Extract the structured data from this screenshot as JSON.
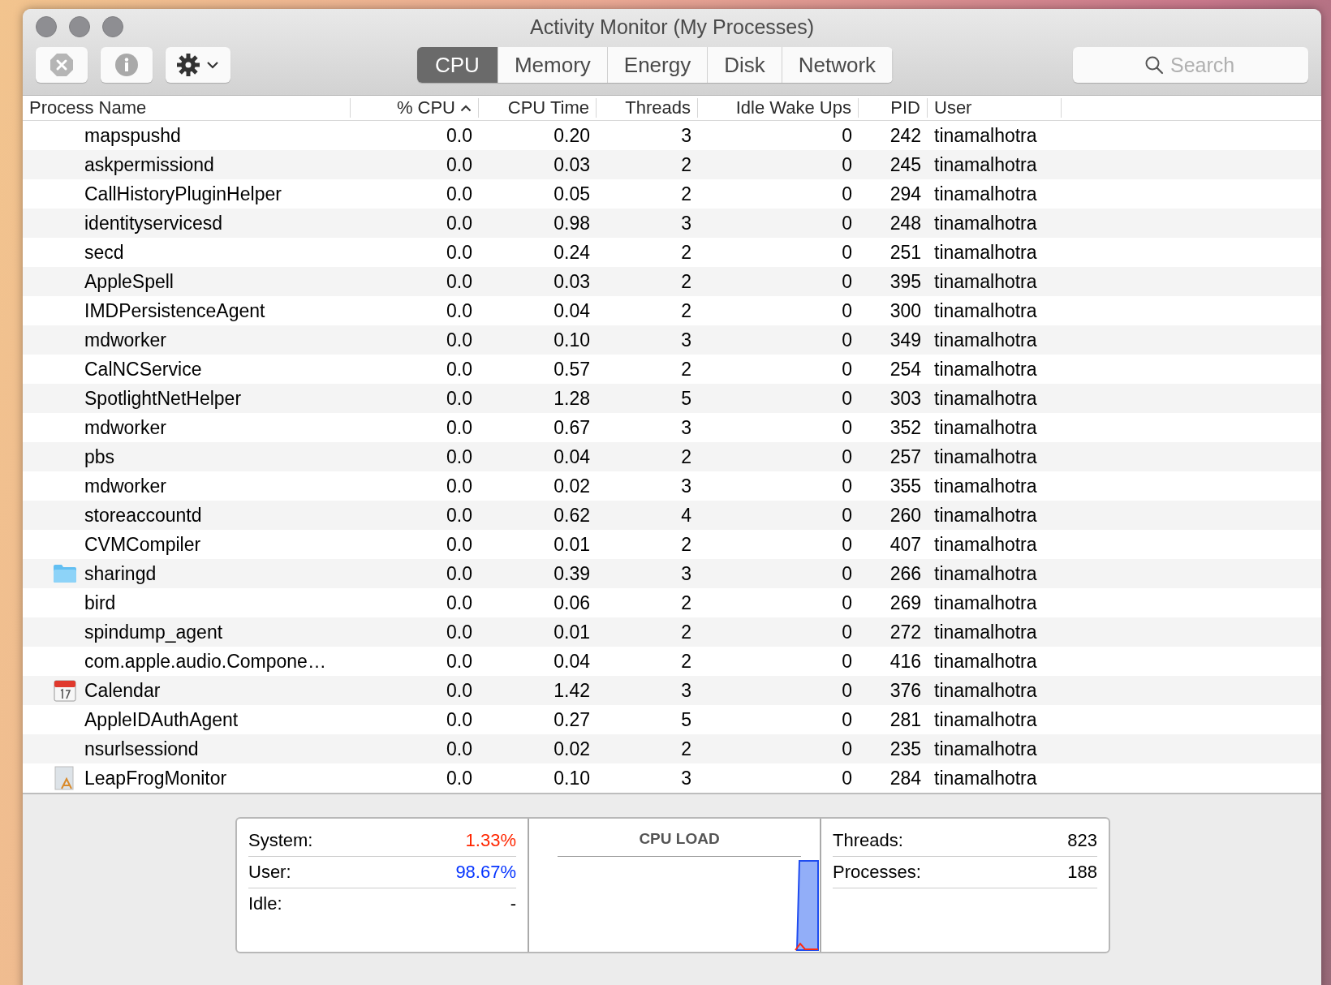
{
  "window": {
    "title": "Activity Monitor (My Processes)"
  },
  "tabs": [
    {
      "label": "CPU",
      "selected": true
    },
    {
      "label": "Memory",
      "selected": false
    },
    {
      "label": "Energy",
      "selected": false
    },
    {
      "label": "Disk",
      "selected": false
    },
    {
      "label": "Network",
      "selected": false
    }
  ],
  "search": {
    "placeholder": "Search"
  },
  "table": {
    "columns": [
      {
        "label": "Process Name",
        "kind": "text",
        "sorted": false
      },
      {
        "label": "% CPU",
        "kind": "number",
        "sorted": true
      },
      {
        "label": "CPU Time",
        "kind": "number",
        "sorted": false
      },
      {
        "label": "Threads",
        "kind": "number",
        "sorted": false
      },
      {
        "label": "Idle Wake Ups",
        "kind": "number",
        "sorted": false
      },
      {
        "label": "PID",
        "kind": "number",
        "sorted": false
      },
      {
        "label": "User",
        "kind": "text",
        "sorted": false
      }
    ],
    "rows": [
      {
        "cells": [
          "mapspushd",
          "0.0",
          "0.20",
          "3",
          "0",
          "242",
          "tinamalhotra"
        ]
      },
      {
        "cells": [
          "askpermissiond",
          "0.0",
          "0.03",
          "2",
          "0",
          "245",
          "tinamalhotra"
        ]
      },
      {
        "cells": [
          "CallHistoryPluginHelper",
          "0.0",
          "0.05",
          "2",
          "0",
          "294",
          "tinamalhotra"
        ]
      },
      {
        "cells": [
          "identityservicesd",
          "0.0",
          "0.98",
          "3",
          "0",
          "248",
          "tinamalhotra"
        ]
      },
      {
        "cells": [
          "secd",
          "0.0",
          "0.24",
          "2",
          "0",
          "251",
          "tinamalhotra"
        ]
      },
      {
        "cells": [
          "AppleSpell",
          "0.0",
          "0.03",
          "2",
          "0",
          "395",
          "tinamalhotra"
        ]
      },
      {
        "cells": [
          "IMDPersistenceAgent",
          "0.0",
          "0.04",
          "2",
          "0",
          "300",
          "tinamalhotra"
        ]
      },
      {
        "cells": [
          "mdworker",
          "0.0",
          "0.10",
          "3",
          "0",
          "349",
          "tinamalhotra"
        ]
      },
      {
        "cells": [
          "CalNCService",
          "0.0",
          "0.57",
          "2",
          "0",
          "254",
          "tinamalhotra"
        ]
      },
      {
        "cells": [
          "SpotlightNetHelper",
          "0.0",
          "1.28",
          "5",
          "0",
          "303",
          "tinamalhotra"
        ]
      },
      {
        "cells": [
          "mdworker",
          "0.0",
          "0.67",
          "3",
          "0",
          "352",
          "tinamalhotra"
        ]
      },
      {
        "cells": [
          "pbs",
          "0.0",
          "0.04",
          "2",
          "0",
          "257",
          "tinamalhotra"
        ]
      },
      {
        "cells": [
          "mdworker",
          "0.0",
          "0.02",
          "3",
          "0",
          "355",
          "tinamalhotra"
        ]
      },
      {
        "cells": [
          "storeaccountd",
          "0.0",
          "0.62",
          "4",
          "0",
          "260",
          "tinamalhotra"
        ]
      },
      {
        "cells": [
          "CVMCompiler",
          "0.0",
          "0.01",
          "2",
          "0",
          "407",
          "tinamalhotra"
        ]
      },
      {
        "kind": "folder",
        "cells": [
          "sharingd",
          "0.0",
          "0.39",
          "3",
          "0",
          "266",
          "tinamalhotra"
        ]
      },
      {
        "cells": [
          "bird",
          "0.0",
          "0.06",
          "2",
          "0",
          "269",
          "tinamalhotra"
        ]
      },
      {
        "cells": [
          "spindump_agent",
          "0.0",
          "0.01",
          "2",
          "0",
          "272",
          "tinamalhotra"
        ]
      },
      {
        "cells": [
          "com.apple.audio.Compone…",
          "0.0",
          "0.04",
          "2",
          "0",
          "416",
          "tinamalhotra"
        ]
      },
      {
        "kind": "calendar",
        "cells": [
          "Calendar",
          "0.0",
          "1.42",
          "3",
          "0",
          "376",
          "tinamalhotra"
        ]
      },
      {
        "cells": [
          "AppleIDAuthAgent",
          "0.0",
          "0.27",
          "5",
          "0",
          "281",
          "tinamalhotra"
        ]
      },
      {
        "cells": [
          "nsurlsessiond",
          "0.0",
          "0.02",
          "2",
          "0",
          "235",
          "tinamalhotra"
        ]
      },
      {
        "kind": "app",
        "cells": [
          "LeapFrogMonitor",
          "0.0",
          "0.10",
          "3",
          "0",
          "284",
          "tinamalhotra"
        ]
      }
    ]
  },
  "cpu_summary": {
    "load": [
      {
        "label": "System:",
        "value": "1.33%",
        "color": "#ff2600"
      },
      {
        "label": "User:",
        "value": "98.67%",
        "color": "#0433ff"
      },
      {
        "label": "Idle:",
        "value": "-",
        "color": "#000000"
      }
    ],
    "graph_title": "CPU LOAD",
    "counts": [
      {
        "label": "Threads:",
        "value": "823"
      },
      {
        "label": "Processes:",
        "value": "188"
      }
    ]
  }
}
